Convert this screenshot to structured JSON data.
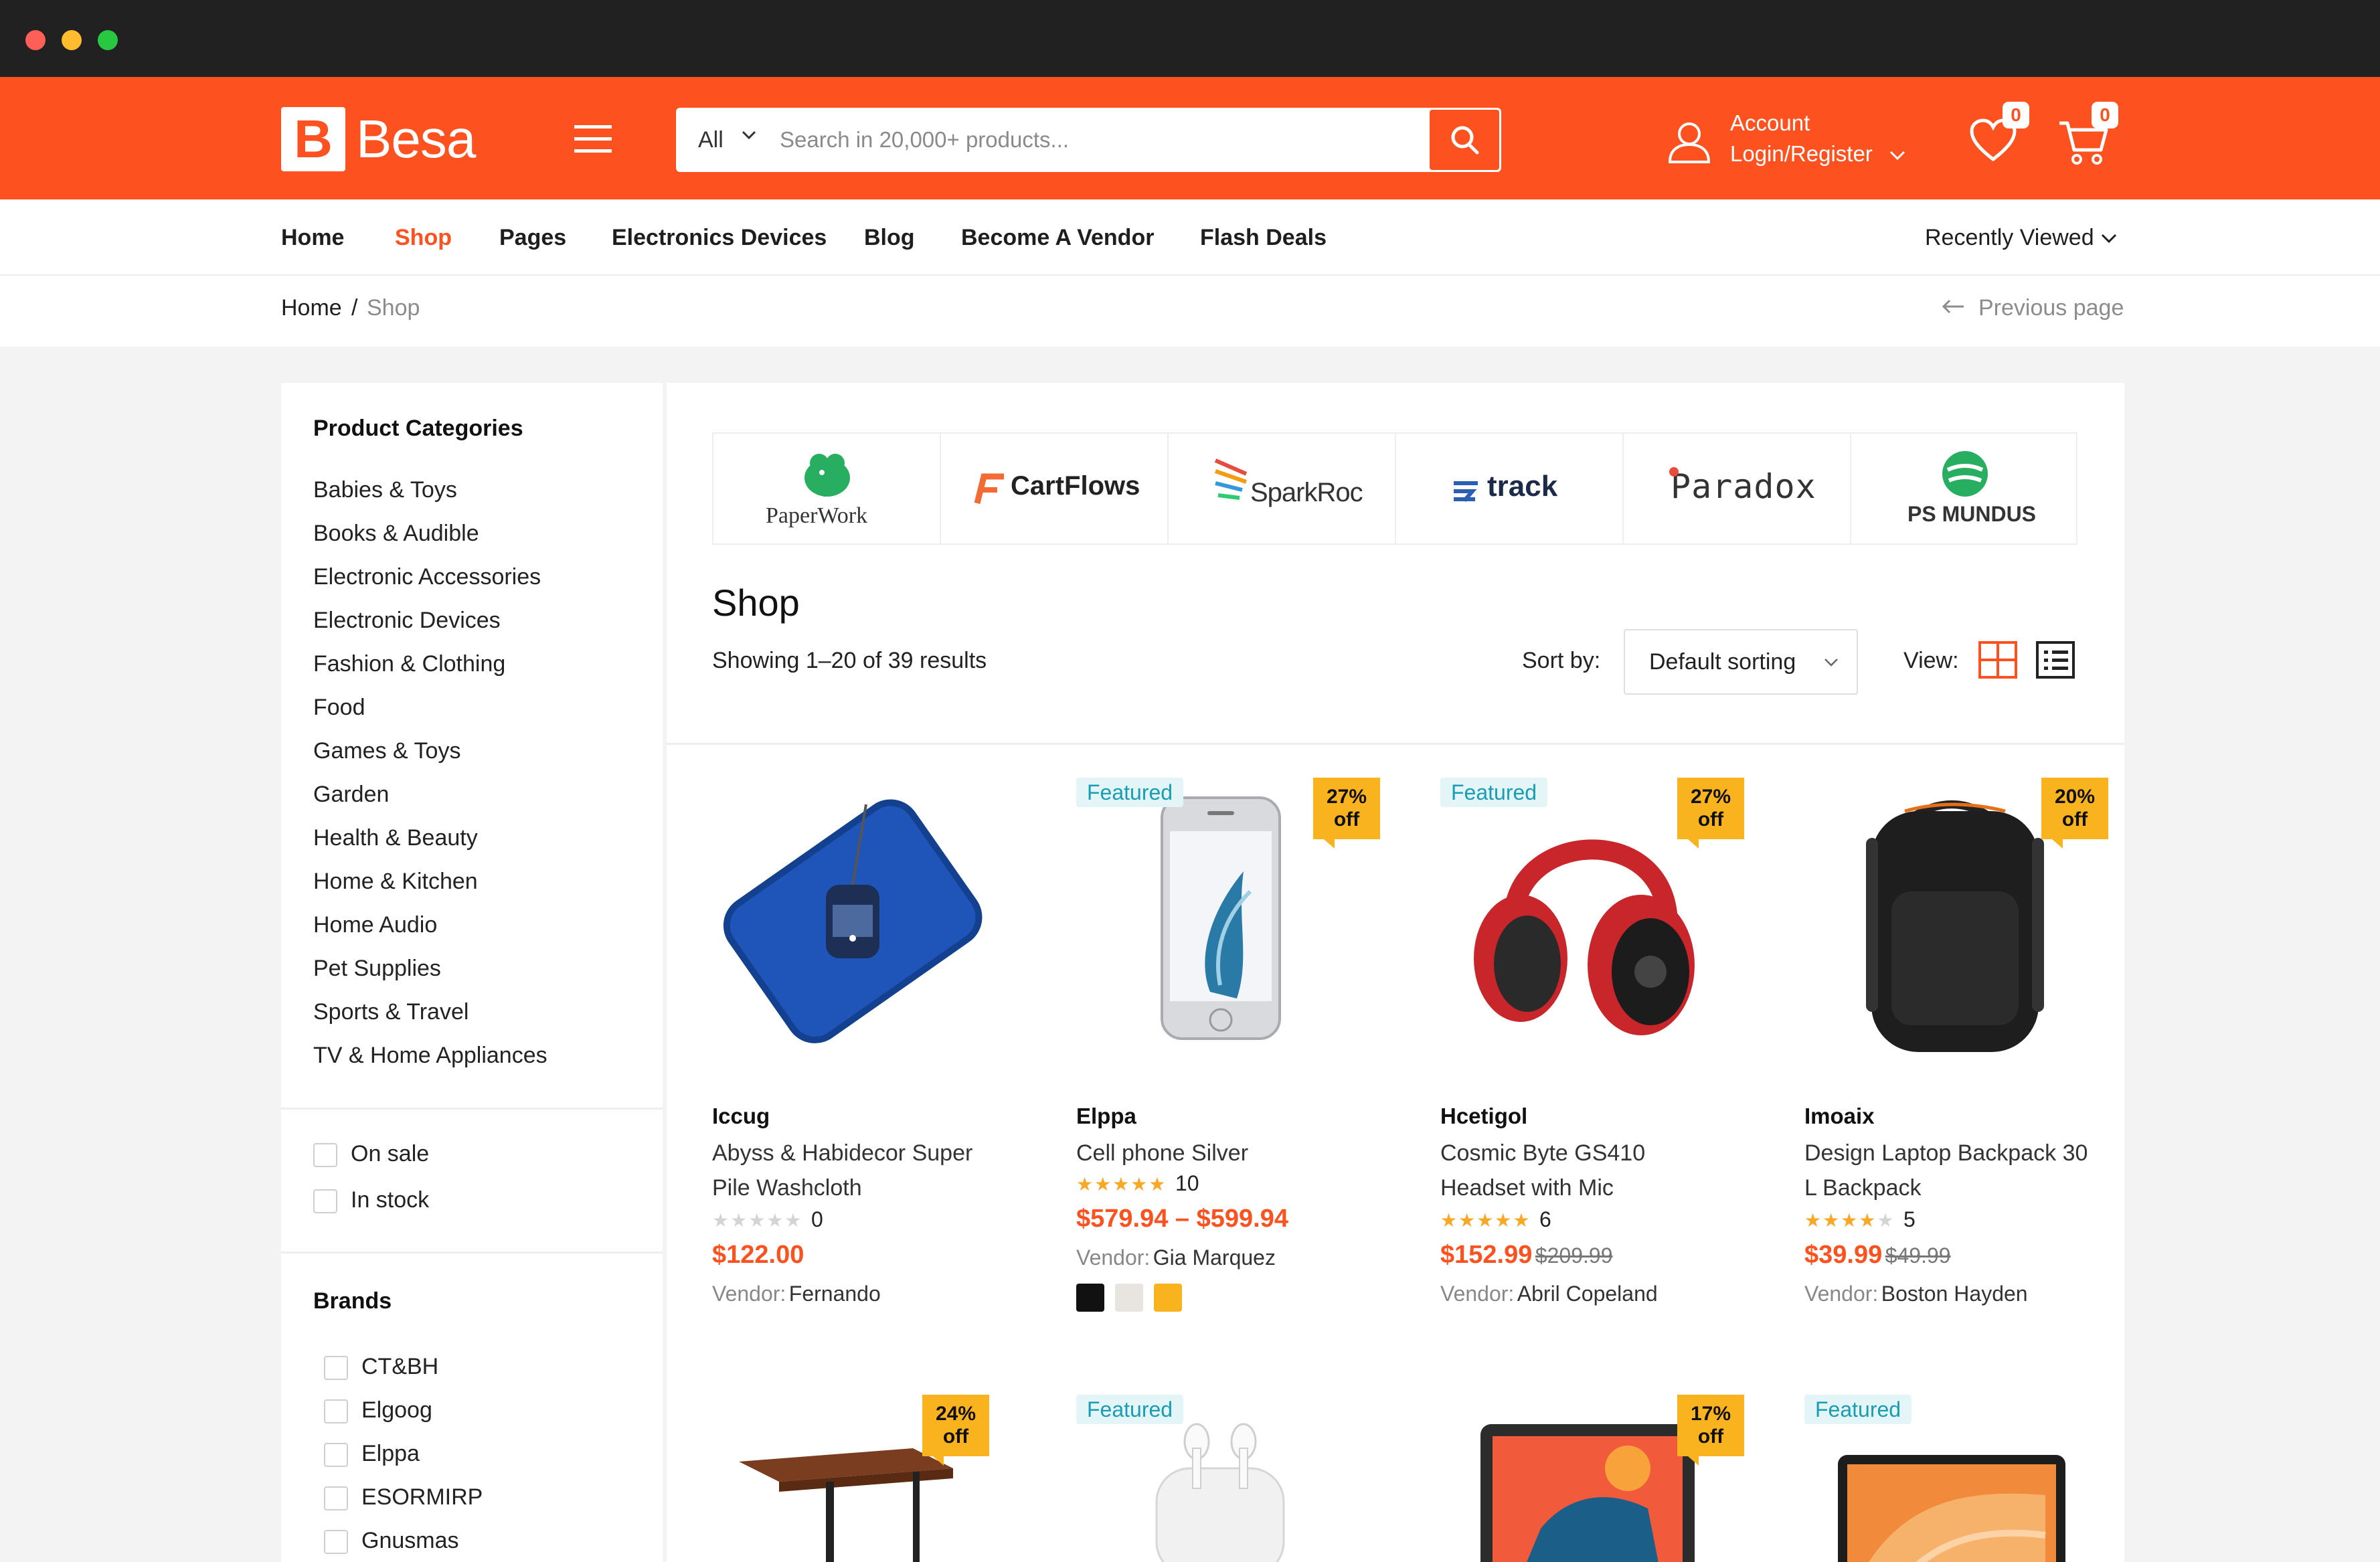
{
  "header": {
    "logo_letter": "B",
    "logo_text": "Besa",
    "search_category": "All",
    "search_placeholder": "Search in 20,000+ products...",
    "account_label": "Account",
    "account_login": "Login/Register",
    "wishlist_count": "0",
    "cart_count": "0",
    "brand_color": "#fd5120"
  },
  "nav": {
    "items": [
      "Home",
      "Shop",
      "Pages",
      "Electronics Devices",
      "Blog",
      "Become A Vendor",
      "Flash Deals"
    ],
    "active": "Shop",
    "recently_viewed": "Recently Viewed"
  },
  "breadcrumb": {
    "home": "Home",
    "separator": "/",
    "current": "Shop",
    "previous_page": "Previous page"
  },
  "sidebar": {
    "categories_title": "Product Categories",
    "categories": [
      "Babies & Toys",
      "Books & Audible",
      "Electronic Accessories",
      "Electronic Devices",
      "Fashion & Clothing",
      "Food",
      "Games & Toys",
      "Garden",
      "Health & Beauty",
      "Home & Kitchen",
      "Home Audio",
      "Pet Supplies",
      "Sports & Travel",
      "TV & Home Appliances"
    ],
    "filters": [
      "On sale",
      "In stock"
    ],
    "brands_title": "Brands",
    "brands": [
      "CT&BH",
      "Elgoog",
      "Elppa",
      "ESORMIRP",
      "Gnusmas"
    ]
  },
  "brand_logos": [
    "PaperWork",
    "CartFlows",
    "SparkRoc",
    "track",
    "Paradox",
    "PS MUNDUS"
  ],
  "shop": {
    "title": "Shop",
    "result_count": "Showing 1–20 of 39 results",
    "sort_label": "Sort by:",
    "sort_value": "Default sorting",
    "view_label": "View:"
  },
  "products": [
    {
      "vendor": "Iccug",
      "title": "Abyss & Habidecor Super Pile Washcloth",
      "rating": 0,
      "rating_count": "0",
      "price": "$122.00",
      "old_price": "",
      "vendor_label": "Vendor:",
      "vendor_name": "Fernando",
      "featured": "",
      "discount": "",
      "image": "blue-washcloth"
    },
    {
      "vendor": "Elppa",
      "title": "Cell phone Silver",
      "rating": 5,
      "rating_count": "10",
      "price": "$579.94 – $599.94",
      "old_price": "",
      "vendor_label": "Vendor:",
      "vendor_name": "Gia Marquez",
      "featured": "Featured",
      "discount": "27% off",
      "image": "silver-phone",
      "swatches": [
        "#111111",
        "#e8e4df",
        "#f9b31f"
      ]
    },
    {
      "vendor": "Hcetigol",
      "title": "Cosmic Byte GS410 Headset with Mic",
      "rating": 5,
      "rating_count": "6",
      "price": "$152.99",
      "old_price": "$209.99",
      "vendor_label": "Vendor:",
      "vendor_name": "Abril Copeland",
      "featured": "Featured",
      "discount": "27% off",
      "image": "red-headphones"
    },
    {
      "vendor": "Imoaix",
      "title": "Design Laptop Backpack 30 L Backpack",
      "rating": 4,
      "rating_count": "5",
      "price": "$39.99",
      "old_price": "$49.99",
      "vendor_label": "Vendor:",
      "vendor_name": "Boston Hayden",
      "featured": "",
      "discount": "20% off",
      "image": "black-backpack"
    }
  ],
  "products_row2": [
    {
      "featured": "",
      "discount": "24% off",
      "image": "wood-table"
    },
    {
      "featured": "Featured",
      "discount": "",
      "image": "white-earbuds"
    },
    {
      "featured": "",
      "discount": "17% off",
      "image": "tablet"
    },
    {
      "featured": "Featured",
      "discount": "",
      "image": "laptop"
    }
  ],
  "colors": {
    "accent": "#fd5120",
    "star": "#f9a825",
    "discount_badge": "#f9b31f",
    "featured_badge_bg": "#e3f5f7",
    "featured_badge_text": "#1a9cb3"
  }
}
